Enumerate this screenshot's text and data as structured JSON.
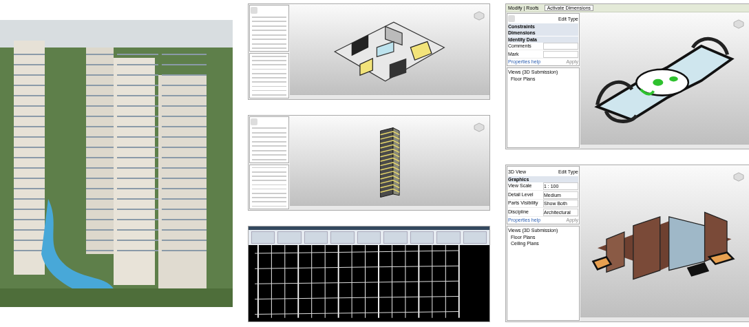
{
  "middle_column": [
    {
      "kind": "revit",
      "model": {
        "kind": "floor-plate"
      }
    },
    {
      "kind": "revit",
      "model": {
        "kind": "tower"
      }
    },
    {
      "kind": "cad-ribbon",
      "model": {
        "kind": "wireframe"
      }
    }
  ],
  "right_column": [
    {
      "kind": "revit",
      "model": {
        "kind": "roof"
      },
      "toolbar": {
        "title": "Modify | Roofs",
        "button": "Activate Dimensions"
      },
      "properties": {
        "edit_type": "Edit Type",
        "sections": [
          {
            "title": "Constraints"
          },
          {
            "title": "Dimensions"
          },
          {
            "title": "Identity Data",
            "rows": [
              {
                "label": "Comments"
              },
              {
                "label": "Mark"
              }
            ]
          }
        ],
        "help": "Properties help",
        "apply": "Apply"
      },
      "browser": [
        {
          "label": "Views (3D Submission)",
          "children": [
            {
              "label": "Floor Plans"
            }
          ]
        }
      ]
    },
    {
      "kind": "revit",
      "model": {
        "kind": "brick"
      },
      "properties": {
        "type": "3D View",
        "edit_type": "Edit Type",
        "sections": [
          {
            "title": "Graphics",
            "rows": [
              {
                "label": "View Scale",
                "value": "1 : 100"
              },
              {
                "label": "Detail Level",
                "value": "Medium"
              },
              {
                "label": "Parts Visibility",
                "value": "Show Both"
              },
              {
                "label": "Discipline",
                "value": "Architectural"
              }
            ]
          }
        ],
        "help": "Properties help",
        "apply": "Apply"
      },
      "browser": [
        {
          "label": "Views (3D Submission)",
          "children": [
            {
              "label": "Floor Plans"
            },
            {
              "label": "Ceiling Plans"
            }
          ]
        }
      ]
    }
  ]
}
